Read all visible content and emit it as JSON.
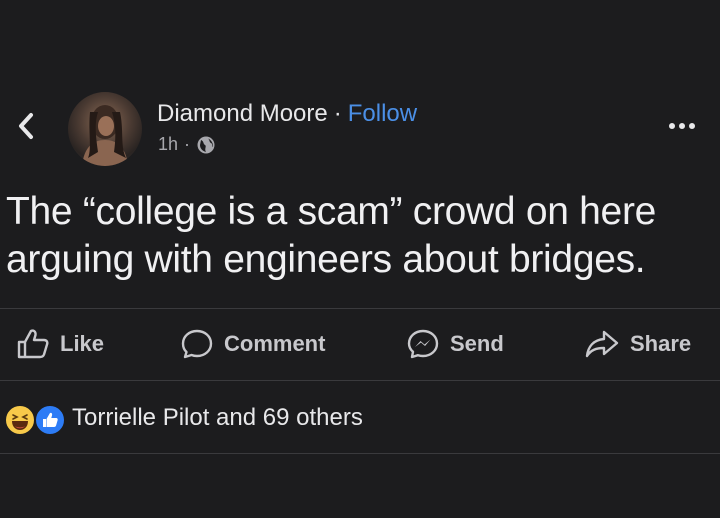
{
  "post": {
    "author": "Diamond Moore",
    "separator": "·",
    "follow_label": "Follow",
    "time": "1h",
    "meta_separator": "·",
    "visibility_icon": "globe-icon",
    "text": "The “college is a scam” crowd on here arguing with engineers about bridges."
  },
  "actions": {
    "like": "Like",
    "comment": "Comment",
    "send": "Send",
    "share": "Share"
  },
  "reactions": {
    "icons": [
      "haha-reaction-icon",
      "like-reaction-icon"
    ],
    "summary": "Torrielle Pilot and 69 others"
  },
  "colors": {
    "background": "#1c1c1e",
    "follow": "#4b8fe6",
    "like_badge": "#2d7cf6",
    "haha_badge": "#f7c94a"
  }
}
